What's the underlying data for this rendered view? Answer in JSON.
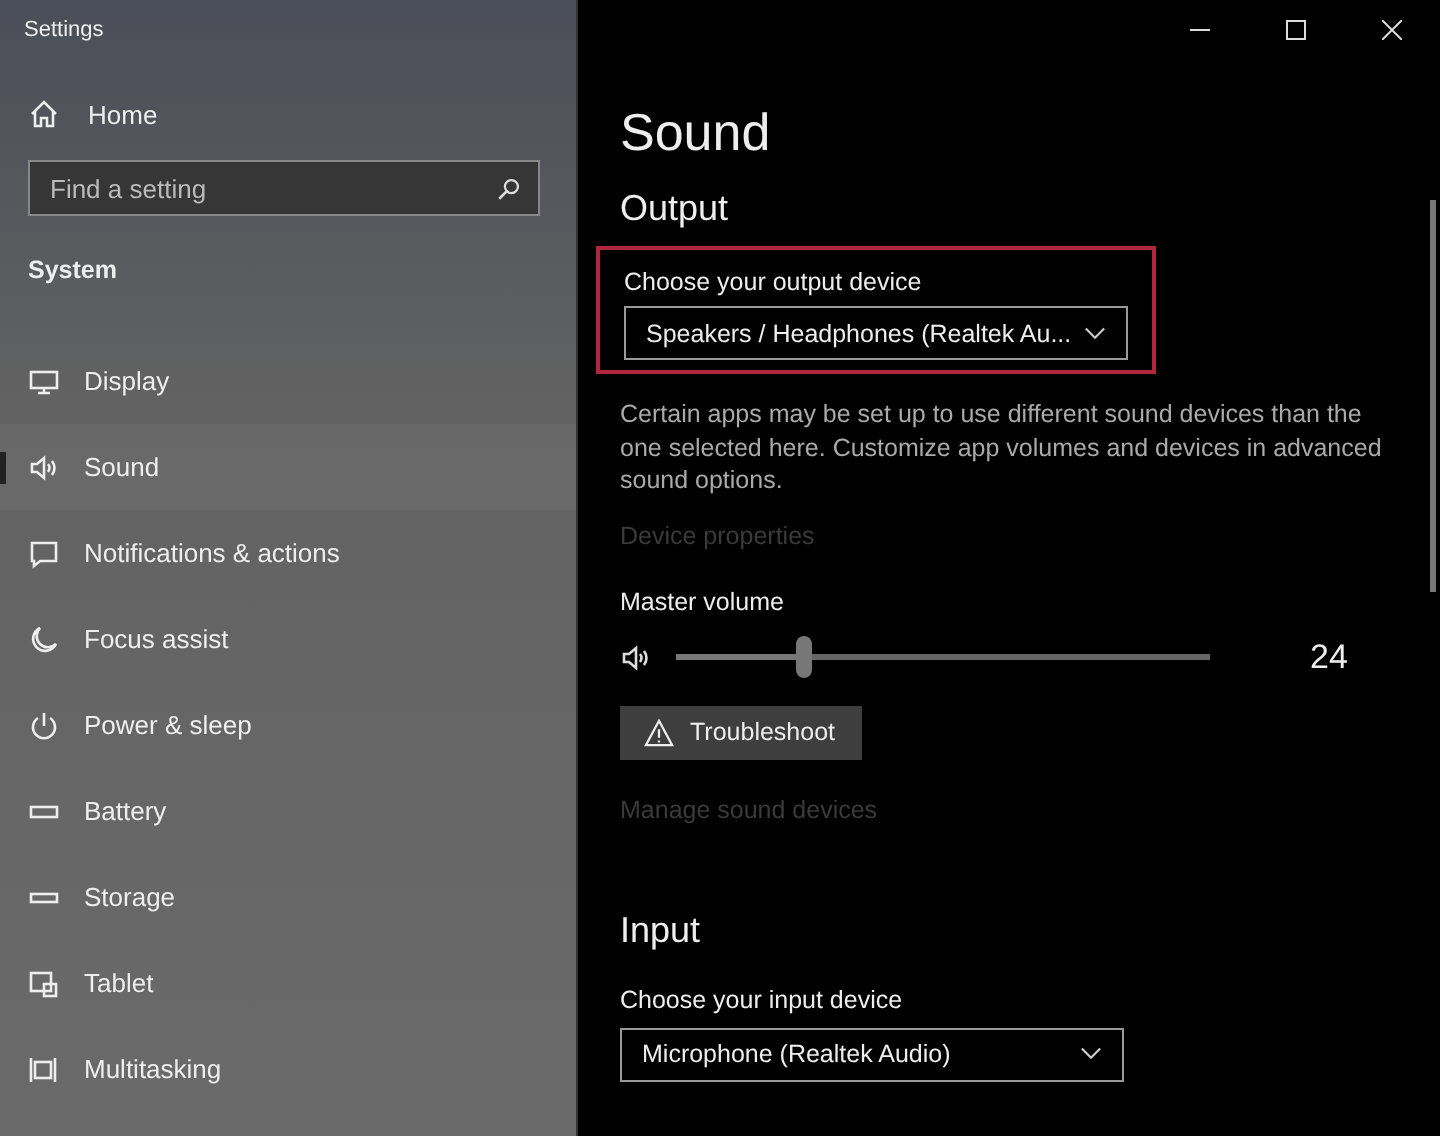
{
  "window": {
    "title": "Settings"
  },
  "sidebar": {
    "home": "Home",
    "search": {
      "placeholder": "Find a setting"
    },
    "section": "System",
    "items": [
      {
        "label": "Display",
        "selected": false
      },
      {
        "label": "Sound",
        "selected": true
      },
      {
        "label": "Notifications & actions",
        "selected": false
      },
      {
        "label": "Focus assist",
        "selected": false
      },
      {
        "label": "Power & sleep",
        "selected": false
      },
      {
        "label": "Battery",
        "selected": false
      },
      {
        "label": "Storage",
        "selected": false
      },
      {
        "label": "Tablet",
        "selected": false
      },
      {
        "label": "Multitasking",
        "selected": false
      }
    ]
  },
  "page": {
    "title": "Sound",
    "output": {
      "heading": "Output",
      "label": "Choose your output device",
      "value": "Speakers / Headphones (Realtek Au...",
      "highlighted": true,
      "description": "Certain apps may be set up to use different sound devices than the one selected here. Customize app volumes and devices in advanced sound options.",
      "link": {
        "label": "Device properties",
        "disabled": true
      },
      "volume": {
        "label": "Master volume",
        "level": 0.24,
        "reading": "24"
      },
      "button": "Troubleshoot",
      "link2": {
        "label": "Manage sound devices",
        "disabled": true
      }
    },
    "input": {
      "heading": "Input",
      "label": "Choose your input device",
      "value": "Microphone (Realtek Audio)"
    }
  }
}
